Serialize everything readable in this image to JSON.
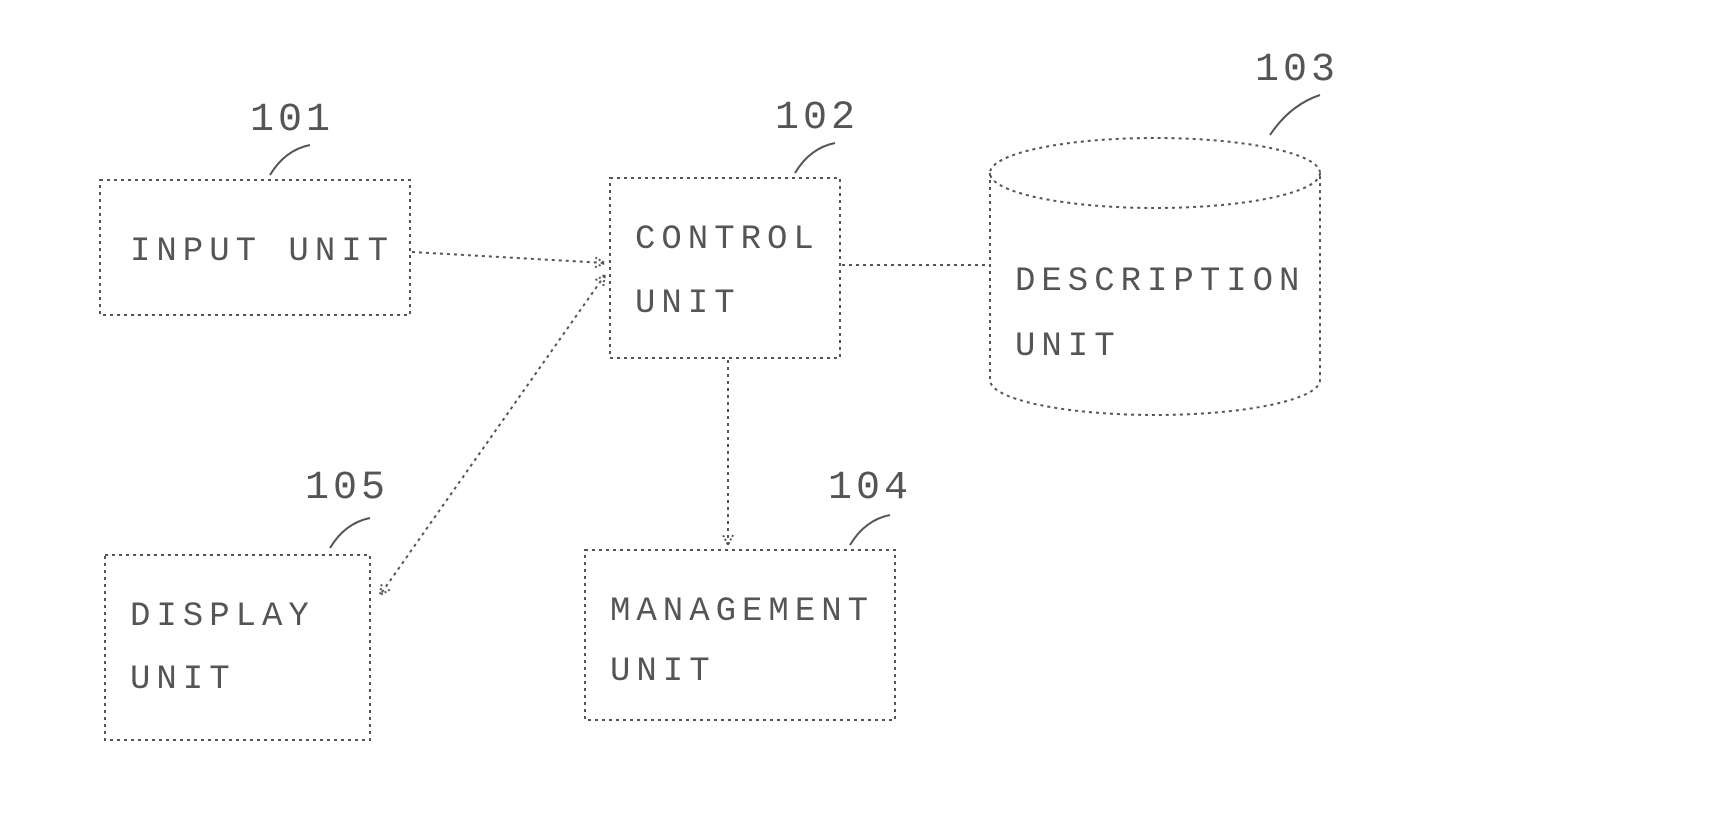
{
  "blocks": {
    "input": {
      "ref": "101",
      "label": "INPUT UNIT"
    },
    "control": {
      "ref": "102",
      "label1": "CONTROL",
      "label2": "UNIT"
    },
    "description": {
      "ref": "103",
      "label1": "DESCRIPTION",
      "label2": "UNIT"
    },
    "management": {
      "ref": "104",
      "label1": "MANAGEMENT",
      "label2": "UNIT"
    },
    "display": {
      "ref": "105",
      "label1": "DISPLAY",
      "label2": "UNIT"
    }
  }
}
